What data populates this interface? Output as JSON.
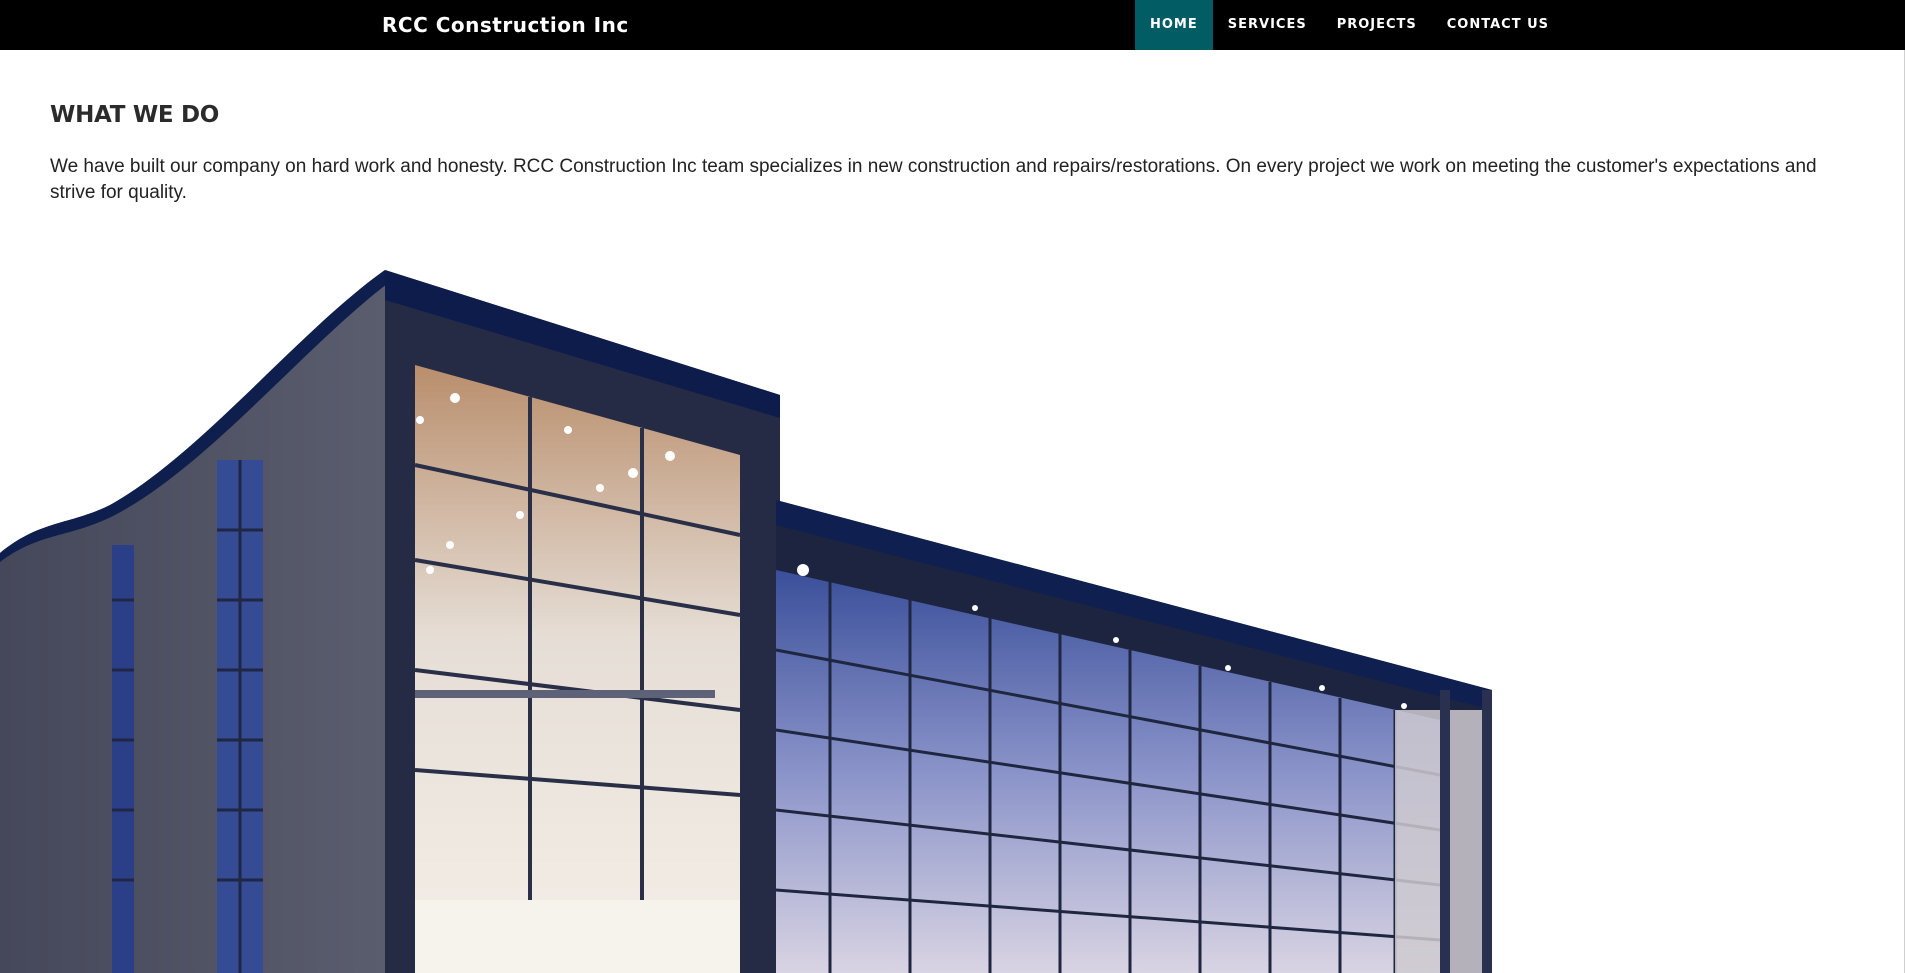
{
  "navbar": {
    "brand": "RCC Construction Inc",
    "items": [
      {
        "label": "HOME",
        "active": true
      },
      {
        "label": "SERVICES",
        "active": false
      },
      {
        "label": "PROJECTS",
        "active": false
      },
      {
        "label": "CONTACT US",
        "active": false
      }
    ]
  },
  "main": {
    "title": "WHAT WE DO",
    "text": "We have built our company on hard work and honesty. RCC Construction Inc team specializes in new construction and repairs/restorations. On every project we work on meeting the customer's expectations and strive for quality."
  },
  "colors": {
    "navbar_bg": "#000000",
    "active_nav_bg": "#025c63",
    "text": "#222222"
  }
}
